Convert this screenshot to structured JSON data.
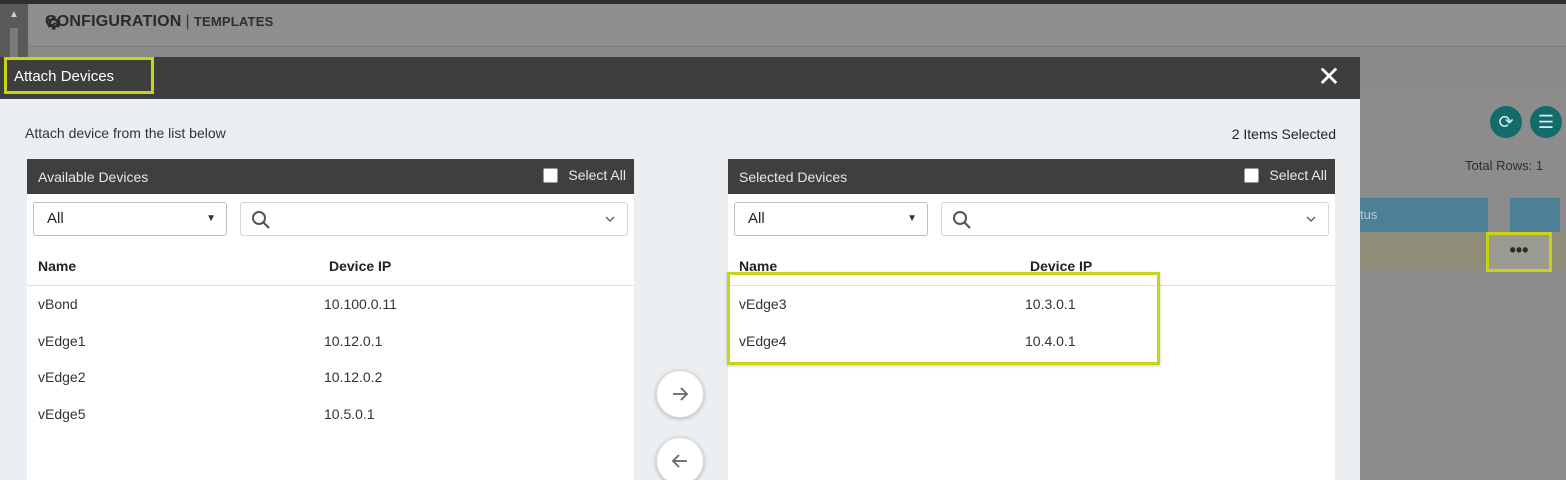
{
  "background": {
    "page_title": "CONFIGURATION",
    "page_separator": "|",
    "page_subtitle": "TEMPLATES",
    "total_rows": "Total Rows: 1",
    "column_header_partial": "tus",
    "more_actions": "•••",
    "icons": [
      "gear-icon",
      "refresh-icon",
      "menu-icon",
      "scroll-up-icon"
    ]
  },
  "modal": {
    "title": "Attach Devices",
    "close": "✕",
    "instruction": "Attach device from the list below",
    "items_selected": "2 Items Selected",
    "available": {
      "title": "Available Devices",
      "select_all": "Select All",
      "filter_value": "All",
      "search_value": "",
      "columns": {
        "name": "Name",
        "ip": "Device IP"
      },
      "rows": [
        {
          "name": "vBond",
          "ip": "10.100.0.11"
        },
        {
          "name": "vEdge1",
          "ip": "10.12.0.1"
        },
        {
          "name": "vEdge2",
          "ip": "10.12.0.2"
        },
        {
          "name": "vEdge5",
          "ip": "10.5.0.1"
        }
      ]
    },
    "selected": {
      "title": "Selected Devices",
      "select_all": "Select All",
      "filter_value": "All",
      "search_value": "",
      "columns": {
        "name": "Name",
        "ip": "Device IP"
      },
      "rows": [
        {
          "name": "vEdge3",
          "ip": "10.3.0.1"
        },
        {
          "name": "vEdge4",
          "ip": "10.4.0.1"
        }
      ]
    },
    "move_right_icon": "arrow-right-icon",
    "move_left_icon": "arrow-left-icon"
  },
  "colors": {
    "highlight": "#c8d418",
    "modal_header": "#3e3e3e",
    "panel_header": "#3f3f3f",
    "teal_button": "#146b6b"
  }
}
